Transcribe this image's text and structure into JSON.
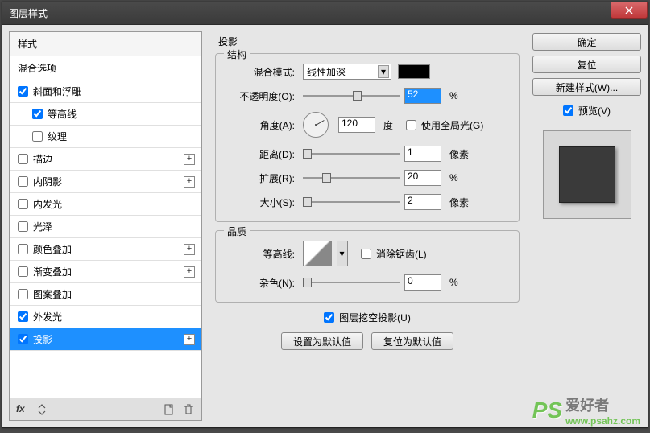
{
  "window": {
    "title": "图层样式",
    "close_icon": "close"
  },
  "left": {
    "header": "样式",
    "subheader": "混合选项",
    "items": [
      {
        "label": "斜面和浮雕",
        "checked": true,
        "plus": false,
        "indent": false
      },
      {
        "label": "等高线",
        "checked": true,
        "plus": false,
        "indent": true
      },
      {
        "label": "纹理",
        "checked": false,
        "plus": false,
        "indent": true
      },
      {
        "label": "描边",
        "checked": false,
        "plus": true,
        "indent": false
      },
      {
        "label": "内阴影",
        "checked": false,
        "plus": true,
        "indent": false
      },
      {
        "label": "内发光",
        "checked": false,
        "plus": false,
        "indent": false
      },
      {
        "label": "光泽",
        "checked": false,
        "plus": false,
        "indent": false
      },
      {
        "label": "颜色叠加",
        "checked": false,
        "plus": true,
        "indent": false
      },
      {
        "label": "渐变叠加",
        "checked": false,
        "plus": true,
        "indent": false
      },
      {
        "label": "图案叠加",
        "checked": false,
        "plus": false,
        "indent": false
      },
      {
        "label": "外发光",
        "checked": true,
        "plus": false,
        "indent": false
      },
      {
        "label": "投影",
        "checked": true,
        "plus": true,
        "indent": false,
        "selected": true
      }
    ],
    "bottom": {
      "fx": "fx"
    }
  },
  "middle": {
    "title": "投影",
    "group1": {
      "legend": "结构",
      "blend_label": "混合模式:",
      "blend_value": "线性加深",
      "opacity_label": "不透明度(O):",
      "opacity_value": "52",
      "opacity_unit": "%",
      "angle_label": "角度(A):",
      "angle_value": "120",
      "angle_unit": "度",
      "global_label": "使用全局光(G)",
      "global_checked": false,
      "distance_label": "距离(D):",
      "distance_value": "1",
      "distance_unit": "像素",
      "spread_label": "扩展(R):",
      "spread_value": "20",
      "spread_unit": "%",
      "size_label": "大小(S):",
      "size_value": "2",
      "size_unit": "像素"
    },
    "group2": {
      "legend": "品质",
      "contour_label": "等高线:",
      "antialias_label": "消除锯齿(L)",
      "antialias_checked": false,
      "noise_label": "杂色(N):",
      "noise_value": "0",
      "noise_unit": "%"
    },
    "knockout_label": "图层挖空投影(U)",
    "knockout_checked": true,
    "btn_default": "设置为默认值",
    "btn_reset": "复位为默认值"
  },
  "right": {
    "ok": "确定",
    "cancel": "复位",
    "new_style": "新建样式(W)...",
    "preview_label": "预览(V)",
    "preview_checked": true
  },
  "watermark": {
    "ps": "PS",
    "txt": "爱好者",
    "url": "www.psahz.com"
  }
}
